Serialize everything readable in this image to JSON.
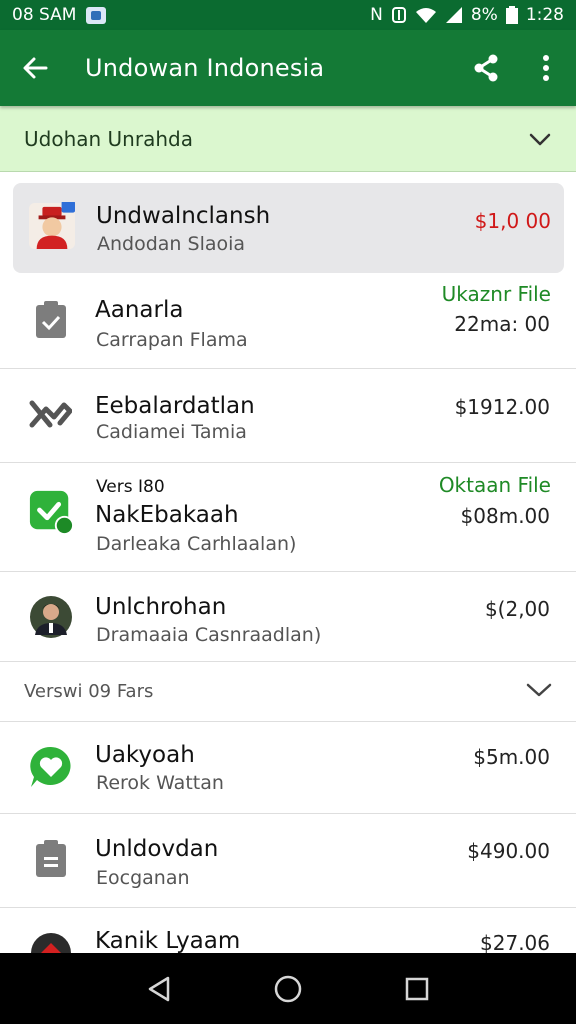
{
  "status_bar": {
    "time_left": "08 SAM",
    "battery": "8%",
    "clock": "1:28",
    "network_letter": "N",
    "icons": [
      "app-notification-icon",
      "nfc-icon",
      "wifi-icon",
      "signal-icon",
      "battery-icon"
    ]
  },
  "app_bar": {
    "title": "Undowan Indonesia",
    "icons": [
      "back-arrow-icon",
      "share-icon",
      "more-vert-icon"
    ]
  },
  "filter": {
    "label": "Udohan Unrahda",
    "icons": [
      "search-icon",
      "chevron-down-icon"
    ]
  },
  "items": [
    {
      "title": "Undwalnclansh",
      "subtitle": "Andodan Slaoia",
      "amount": "$1,0 00",
      "status": "",
      "pretitle": "",
      "icon": "avatar-icon",
      "highlight": true,
      "amount_color": "#d01818"
    },
    {
      "title": "Aanarla",
      "subtitle": "Carrapan Flama",
      "amount": "22ma: 00",
      "status": "Ukaznr File",
      "pretitle": "",
      "icon": "clipboard-check-icon"
    },
    {
      "title": "Eebalardatlan",
      "subtitle": "Cadiamei Tamia",
      "amount": "$1912.00",
      "status": "",
      "pretitle": "",
      "icon": "link-broken-icon"
    },
    {
      "title": "NakEbakaah",
      "subtitle": "Darleaka Carhlaalan)",
      "amount": "$08m.00",
      "status": "Oktaan File",
      "pretitle": "Vers I80",
      "icon": "verified-badge-icon"
    },
    {
      "title": "Unlchrohan",
      "subtitle": "Dramaaia Casnraadlan)",
      "amount": "$(2,00",
      "status": "",
      "pretitle": "",
      "icon": "person-avatar-icon"
    }
  ],
  "section": {
    "label": "Verswi 09 Fars",
    "icon": "chevron-down-icon"
  },
  "items2": [
    {
      "title": "Uakyoah",
      "subtitle": "Rerok Wattan",
      "amount": "$5m.00",
      "icon": "chat-heart-icon"
    },
    {
      "title": "Unldovdan",
      "subtitle": "Eocganan",
      "amount": "$490.00",
      "icon": "clipboard-list-icon"
    },
    {
      "title": "Kanik Lyaam",
      "subtitle": "",
      "amount": "$27.06",
      "icon": "red-logo-icon"
    }
  ],
  "nav": {
    "icons": [
      "back-triangle-icon",
      "home-circle-icon",
      "recents-square-icon"
    ]
  },
  "colors": {
    "app_bar": "#147a36",
    "status_bar": "#0b6b30",
    "filter_bg": "#dbf7cf",
    "status_green": "#1f8a26",
    "amount_red": "#d01818"
  }
}
